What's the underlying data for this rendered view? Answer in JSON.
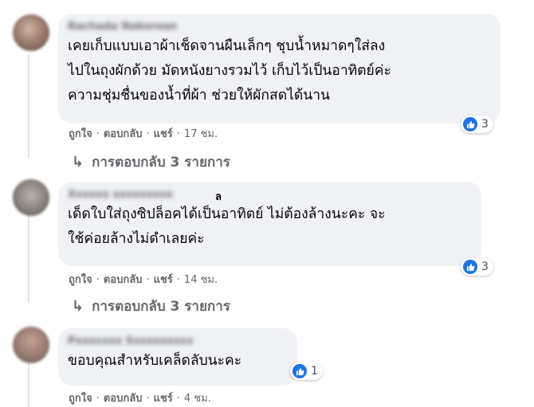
{
  "comments": [
    {
      "author": "Rachada Nakorean",
      "author_suffix": "",
      "text": "เคยเก็บแบบเอาผ้าเช็ดจานผืนเล็กๆ ชุบน้ำหมาดๆใส่ลง\nไปในถุงผักด้วย มัดหนังยางรวมไว้ เก็บไว้เป็นอาทิตย์ค่ะ\nความชุ่มชื่นของน้ำที่ผ้า ช่วยให้ผักสดได้นาน",
      "reactions": "3",
      "like": "ถูกใจ",
      "reply": "ตอบกลับ",
      "share": "แชร์",
      "time": "17 ชม.",
      "replies_label": "การตอบกลับ 3 รายการ"
    },
    {
      "author": "Xxxxxx xxxxxxxxx",
      "author_suffix": "ล",
      "text": "เด็ดใบใส่ถุงซิปล็อคได้เป็นอาทิตย์ ไม่ต้องล้างนะคะ จะ\nใช้ค่อยล้างไม่ดำเลยค่ะ",
      "reactions": "3",
      "like": "ถูกใจ",
      "reply": "ตอบกลับ",
      "share": "แชร์",
      "time": "14 ชม.",
      "replies_label": "การตอบกลับ 3 รายการ"
    },
    {
      "author": "Pxxxxxxx Sxxxxxxxxx",
      "author_suffix": "",
      "text": "ขอบคุณสำหรับเคล็ดลับนะคะ",
      "reactions": "1",
      "like": "ถูกใจ",
      "reply": "ตอบกลับ",
      "share": "แชร์",
      "time": "4 ชม."
    }
  ],
  "separator": "·",
  "reply_arrow": "↳",
  "icons": {
    "reaction": "like-thumb-icon"
  },
  "colors": {
    "like_blue": "#1b74e4",
    "bubble": "#f0f2f5",
    "meta": "#65676b"
  }
}
